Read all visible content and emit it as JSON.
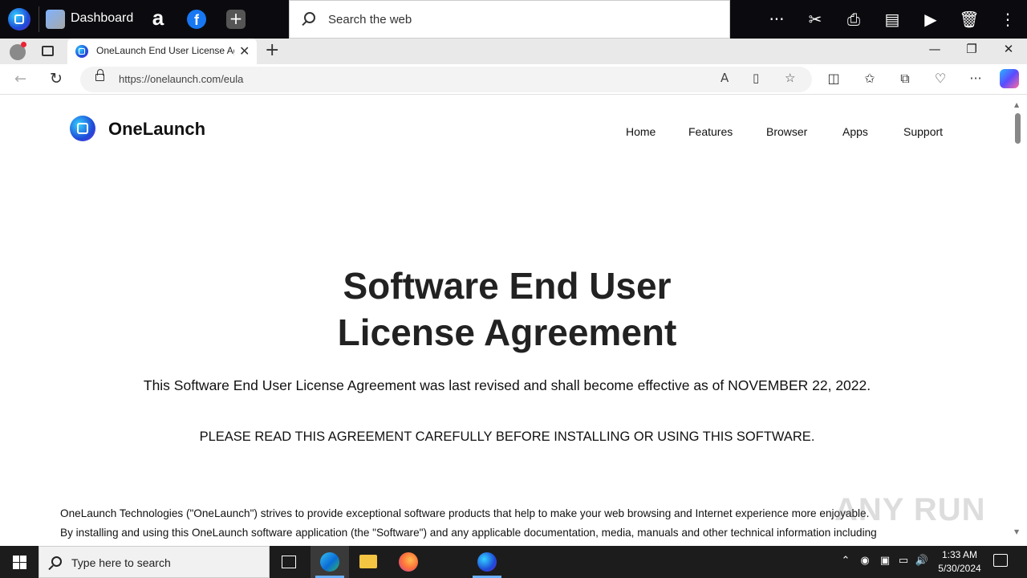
{
  "onelaunch_bar": {
    "dashboard_label": "Dashboard",
    "search_placeholder": "Search the web",
    "tools": [
      "more-icon",
      "scissors-icon",
      "print-icon",
      "clipboard-icon",
      "play-icon",
      "trash-icon",
      "kebab-icon"
    ]
  },
  "browser": {
    "tab_title": "OneLaunch End User License Agreement",
    "url": "https://onelaunch.com/eula"
  },
  "page": {
    "brand": "OneLaunch",
    "nav": [
      "Home",
      "Features",
      "Browser",
      "Apps",
      "Support"
    ],
    "heading_line1": "Software End User",
    "heading_line2": "License Agreement",
    "revised": "This Software End User License Agreement was last revised and shall become effective as of NOVEMBER 22, 2022.",
    "please": "PLEASE READ THIS AGREEMENT CAREFULLY BEFORE INSTALLING OR USING THIS SOFTWARE.",
    "para1": "OneLaunch Technologies (\"OneLaunch\") strives to provide exceptional software products that help to make your web browsing and Internet experience more enjoyable.",
    "para2": "By installing and using this OneLaunch software application (the \"Software\") and any applicable documentation, media, manuals and other technical information including",
    "watermark": "ANY RUN"
  },
  "taskbar": {
    "search_placeholder": "Type here to search",
    "time": "1:33 AM",
    "date": "5/30/2024"
  }
}
